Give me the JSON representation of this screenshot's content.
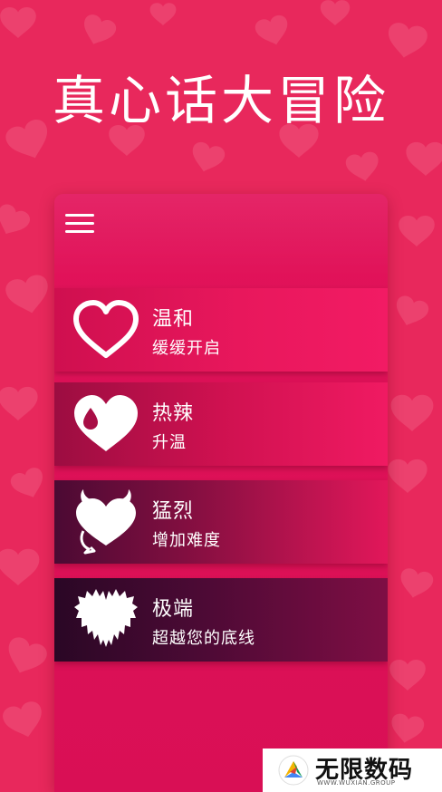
{
  "app": {
    "title": "真心话大冒险"
  },
  "menu": {
    "icon": "hamburger-menu-icon"
  },
  "modes": [
    {
      "name": "温和",
      "description": "缓缓开启",
      "icon": "heart-outline-icon"
    },
    {
      "name": "热辣",
      "description": "升温",
      "icon": "heart-drop-icon"
    },
    {
      "name": "猛烈",
      "description": "增加难度",
      "icon": "devil-heart-icon"
    },
    {
      "name": "极端",
      "description": "超越您的底线",
      "icon": "jagged-heart-icon"
    }
  ],
  "watermark": {
    "brand": "无限数码",
    "url": "WWW.WUXIAN.GROUP"
  },
  "colors": {
    "background": "#e8285c",
    "panel": "#e2135a",
    "text": "#ffffff"
  }
}
